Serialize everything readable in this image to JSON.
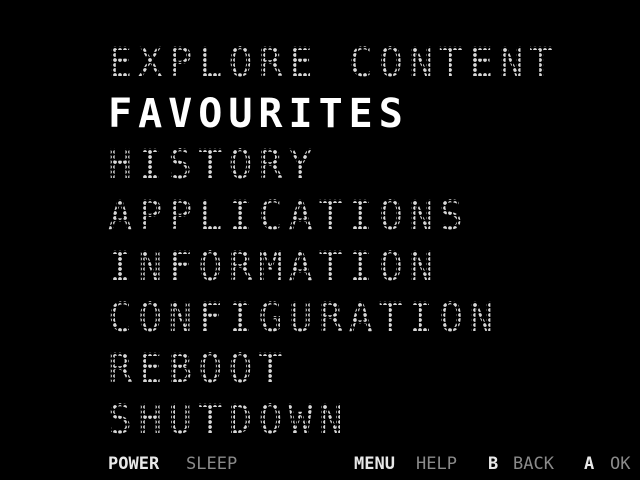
{
  "menu": {
    "selected_index": 1,
    "items": [
      {
        "label": "EXPLORE CONTENT"
      },
      {
        "label": "FAVOURITES"
      },
      {
        "label": "HISTORY"
      },
      {
        "label": "APPLICATIONS"
      },
      {
        "label": "INFORMATION"
      },
      {
        "label": "CONFIGURATION"
      },
      {
        "label": "REBOOT"
      },
      {
        "label": "SHUTDOWN"
      }
    ]
  },
  "footer": {
    "power_key": "POWER",
    "power_action": "SLEEP",
    "menu_key": "MENU",
    "menu_action": "HELP",
    "b_key": "B",
    "b_action": "BACK",
    "a_key": "A",
    "a_action": "OK"
  },
  "colors": {
    "background": "#000000",
    "text": "#d8d8d8",
    "selected": "#ffffff",
    "hint_label": "#8a8a8a"
  }
}
